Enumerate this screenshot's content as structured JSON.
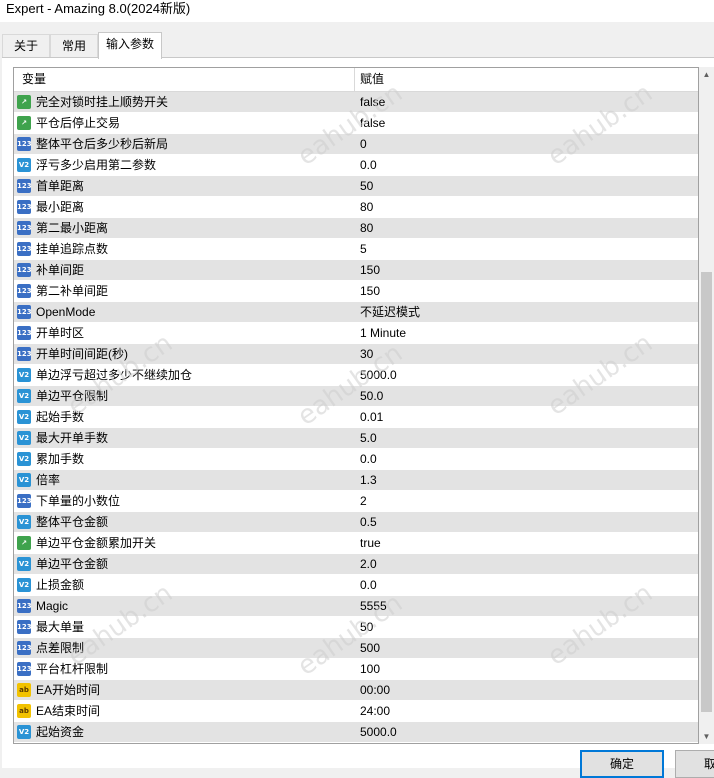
{
  "window": {
    "title": "Expert - Amazing 8.0(2024新版)"
  },
  "tabs": [
    {
      "label": "关于"
    },
    {
      "label": "常用"
    },
    {
      "label": "输入参数"
    }
  ],
  "grid": {
    "col_name": "变量",
    "col_value": "赋值"
  },
  "params": [
    {
      "type": "bool",
      "name": "完全对锁时挂上顺势开关",
      "value": "false"
    },
    {
      "type": "bool",
      "name": "平仓后停止交易",
      "value": "false"
    },
    {
      "type": "int",
      "name": "整体平仓后多少秒后新局",
      "value": "0"
    },
    {
      "type": "double",
      "name": "浮亏多少启用第二参数",
      "value": "0.0"
    },
    {
      "type": "int",
      "name": "首单距离",
      "value": "50"
    },
    {
      "type": "int",
      "name": "最小距离",
      "value": "80"
    },
    {
      "type": "int",
      "name": "第二最小距离",
      "value": "80"
    },
    {
      "type": "int",
      "name": "挂单追踪点数",
      "value": "5"
    },
    {
      "type": "int",
      "name": "补单间距",
      "value": "150"
    },
    {
      "type": "int",
      "name": "第二补单间距",
      "value": "150"
    },
    {
      "type": "int",
      "name": "OpenMode",
      "value": "不延迟模式"
    },
    {
      "type": "int",
      "name": "开单时区",
      "value": "1 Minute"
    },
    {
      "type": "int",
      "name": "开单时间间距(秒)",
      "value": "30"
    },
    {
      "type": "double",
      "name": "单边浮亏超过多少不继续加仓",
      "value": "5000.0"
    },
    {
      "type": "double",
      "name": "单边平仓限制",
      "value": "50.0"
    },
    {
      "type": "double",
      "name": "起始手数",
      "value": "0.01"
    },
    {
      "type": "double",
      "name": "最大开单手数",
      "value": "5.0"
    },
    {
      "type": "double",
      "name": "累加手数",
      "value": "0.0"
    },
    {
      "type": "double",
      "name": "倍率",
      "value": "1.3"
    },
    {
      "type": "int",
      "name": "下单量的小数位",
      "value": "2"
    },
    {
      "type": "double",
      "name": "整体平仓金额",
      "value": "0.5"
    },
    {
      "type": "bool",
      "name": "单边平仓金额累加开关",
      "value": "true"
    },
    {
      "type": "double",
      "name": "单边平仓金额",
      "value": "2.0"
    },
    {
      "type": "double",
      "name": "止损金额",
      "value": "0.0"
    },
    {
      "type": "int",
      "name": "Magic",
      "value": "5555"
    },
    {
      "type": "int",
      "name": "最大单量",
      "value": "50"
    },
    {
      "type": "int",
      "name": "点差限制",
      "value": "500"
    },
    {
      "type": "int",
      "name": "平台杠杆限制",
      "value": "100"
    },
    {
      "type": "string",
      "name": "EA开始时间",
      "value": "00:00"
    },
    {
      "type": "string",
      "name": "EA结束时间",
      "value": "24:00"
    },
    {
      "type": "double",
      "name": "起始资金",
      "value": "5000.0"
    }
  ],
  "type_icons": {
    "bool": {
      "icon": "bool-param-icon",
      "glyph": "↗"
    },
    "int": {
      "icon": "integer-param-icon",
      "glyph": "123"
    },
    "double": {
      "icon": "double-param-icon",
      "glyph": "V2"
    },
    "string": {
      "icon": "string-param-icon",
      "glyph": "ab"
    }
  },
  "buttons": {
    "ok": "确定",
    "cancel": "取"
  },
  "watermark": "eahub.cn"
}
